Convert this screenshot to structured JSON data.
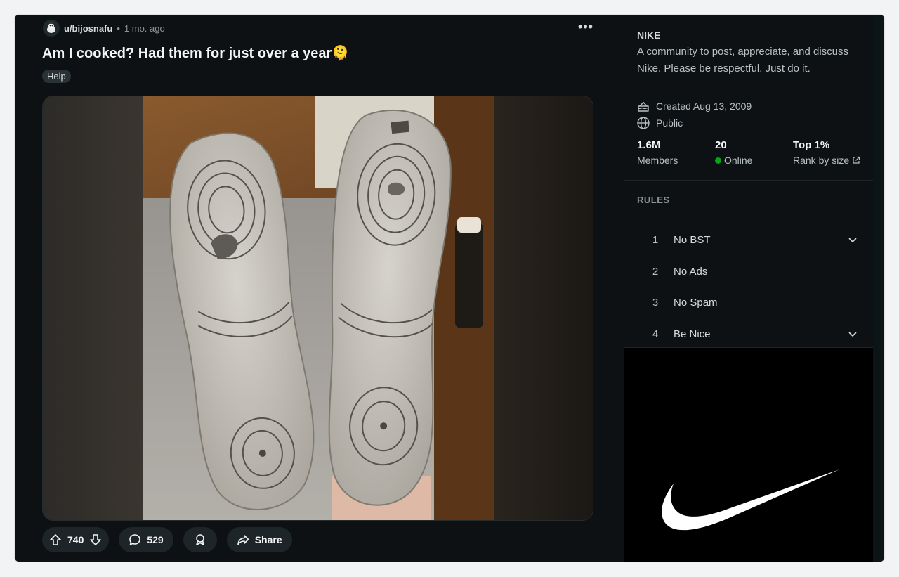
{
  "post": {
    "username": "u/bijosnafu",
    "separator": "•",
    "time": "1 mo. ago",
    "title": "Am I cooked? Had them for just over a year🫠",
    "flair": "Help",
    "more_label": "•••",
    "image_alt": "Worn white sneaker soles with holes in the heels"
  },
  "actions": {
    "vote_count": "740",
    "comment_count": "529",
    "share_label": "Share"
  },
  "community": {
    "name": "NIKE",
    "description": "A community to post, appreciate, and discuss Nike. Please be respectful. Just do it.",
    "created": "Created Aug 13, 2009",
    "visibility": "Public",
    "stats": [
      {
        "value": "1.6M",
        "label": "Members"
      },
      {
        "value": "20",
        "label": "Online"
      },
      {
        "value": "Top 1%",
        "label": "Rank by size"
      }
    ]
  },
  "rules": {
    "heading": "RULES",
    "items": [
      {
        "number": "1",
        "title": "No BST",
        "expandable": true
      },
      {
        "number": "2",
        "title": "No Ads",
        "expandable": false
      },
      {
        "number": "3",
        "title": "No Spam",
        "expandable": false
      },
      {
        "number": "4",
        "title": "Be Nice",
        "expandable": true
      }
    ]
  },
  "colors": {
    "background": "#0e1113",
    "sidebar": "#000000",
    "online": "#01a816",
    "pill": "#1e2528"
  }
}
